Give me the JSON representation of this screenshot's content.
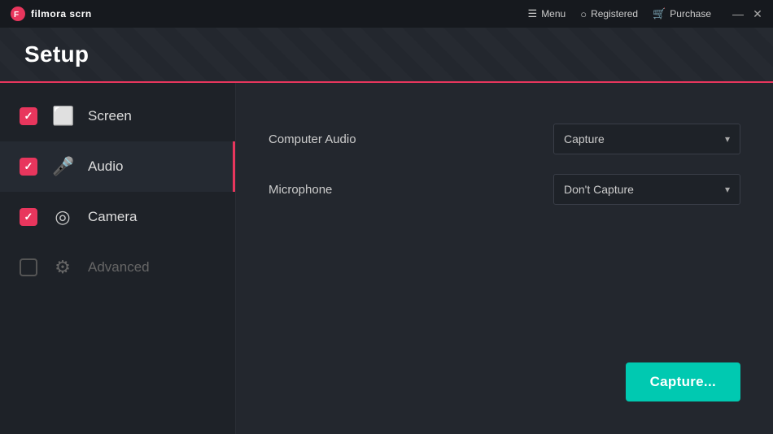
{
  "titlebar": {
    "logo_text": "filmora scrn",
    "menu_label": "Menu",
    "registered_label": "Registered",
    "purchase_label": "Purchase",
    "minimize_symbol": "—",
    "close_symbol": "✕"
  },
  "header": {
    "title": "Setup"
  },
  "sidebar": {
    "items": [
      {
        "id": "screen",
        "label": "Screen",
        "checked": true,
        "active": false,
        "dimmed": false,
        "icon": "🖥"
      },
      {
        "id": "audio",
        "label": "Audio",
        "checked": true,
        "active": true,
        "dimmed": false,
        "icon": "🎤"
      },
      {
        "id": "camera",
        "label": "Camera",
        "checked": true,
        "active": false,
        "dimmed": false,
        "icon": "📷"
      },
      {
        "id": "advanced",
        "label": "Advanced",
        "checked": false,
        "active": false,
        "dimmed": true,
        "icon": "⚙"
      }
    ]
  },
  "content": {
    "settings": [
      {
        "id": "computer-audio",
        "label": "Computer Audio",
        "selected": "Capture",
        "options": [
          "Capture",
          "Don't Capture"
        ]
      },
      {
        "id": "microphone",
        "label": "Microphone",
        "selected": "Don't Capture",
        "options": [
          "Capture",
          "Don't Capture"
        ]
      }
    ],
    "capture_button_label": "Capture..."
  }
}
